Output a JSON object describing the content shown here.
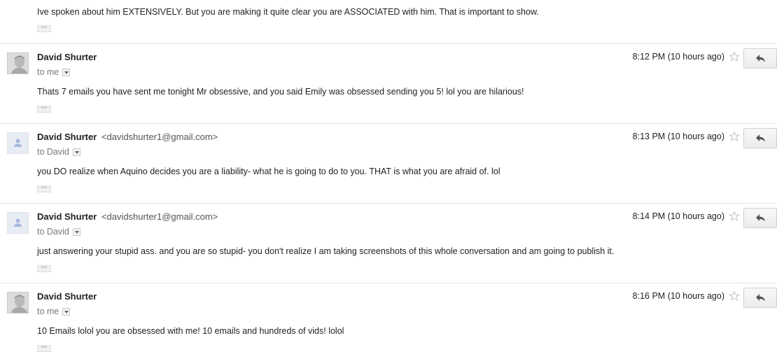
{
  "thread": {
    "top_message": {
      "body": "Ive spoken about him EXTENSIVELY.  But you are making it quite clear you are ASSOCIATED with him.  That is important to show.",
      "show_trimmed": "···"
    },
    "messages": [
      {
        "sender_name": "David Shurter",
        "sender_email": "",
        "avatar": "photo-avatar",
        "recipient": "to me",
        "time": "8:12 PM (10 hours ago)",
        "body": "Thats 7 emails you have sent me tonight Mr obsessive, and you said Emily was obsessed sending you 5! lol you are hilarious!",
        "show_trimmed": "···"
      },
      {
        "sender_name": "David Shurter",
        "sender_email": "<davidshurter1@gmail.com>",
        "avatar": "default-person-avatar",
        "recipient": "to David",
        "time": "8:13 PM (10 hours ago)",
        "body": "you DO realize when Aquino decides you are a liability- what he is going to do to you.  THAT is what you are afraid of.  lol",
        "show_trimmed": "···"
      },
      {
        "sender_name": "David Shurter",
        "sender_email": "<davidshurter1@gmail.com>",
        "avatar": "default-person-avatar",
        "recipient": "to David",
        "time": "8:14 PM (10 hours ago)",
        "body": "just answering your stupid ass.  and you are so stupid- you don't realize I am taking screenshots of this whole conversation and am going to publish it.",
        "show_trimmed": "···"
      },
      {
        "sender_name": "David Shurter",
        "sender_email": "",
        "avatar": "photo-avatar",
        "recipient": "to me",
        "time": "8:16 PM (10 hours ago)",
        "body": "10 Emails lolol you are obsessed with me! 10 emails and hundreds of vids! lolol",
        "show_trimmed": "···"
      }
    ]
  },
  "colors": {
    "divider": "#e5e5e5",
    "text": "#222222",
    "muted": "#777777",
    "default_avatar_figure": "#a5b9dc"
  },
  "icons": {
    "star": "star-outline-icon",
    "reply": "reply-arrow-icon",
    "recipient_dropdown": "chevron-down-icon"
  }
}
